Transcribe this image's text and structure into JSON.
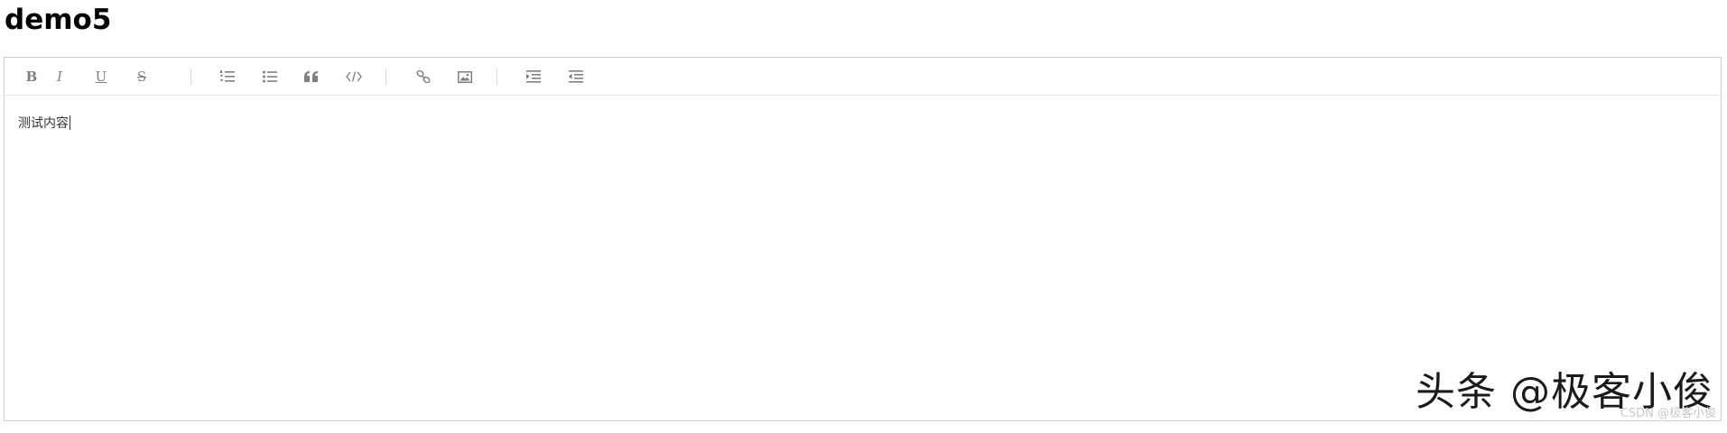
{
  "page": {
    "title": "demo5"
  },
  "toolbar": {
    "buttons": [
      {
        "name": "bold",
        "icon": "bold-icon",
        "label": "B"
      },
      {
        "name": "italic",
        "icon": "italic-icon",
        "label": "I"
      },
      {
        "name": "underline",
        "icon": "underline-icon",
        "label": "U"
      },
      {
        "name": "strike",
        "icon": "strikethrough-icon",
        "label": "S"
      },
      {
        "name": "ordered-list",
        "icon": "ordered-list-icon"
      },
      {
        "name": "bullet-list",
        "icon": "bullet-list-icon"
      },
      {
        "name": "blockquote",
        "icon": "quote-icon"
      },
      {
        "name": "code-block",
        "icon": "code-icon"
      },
      {
        "name": "link",
        "icon": "link-icon"
      },
      {
        "name": "image",
        "icon": "image-icon"
      },
      {
        "name": "indent-increase",
        "icon": "indent-icon"
      },
      {
        "name": "indent-decrease",
        "icon": "outdent-icon"
      }
    ]
  },
  "editor": {
    "content": "测试内容"
  },
  "watermark": {
    "main": "头条 @极客小俊",
    "small": "CSDN @极客小俊"
  },
  "colors": {
    "border": "#cccccc",
    "icon": "#808080",
    "text": "#333333"
  }
}
